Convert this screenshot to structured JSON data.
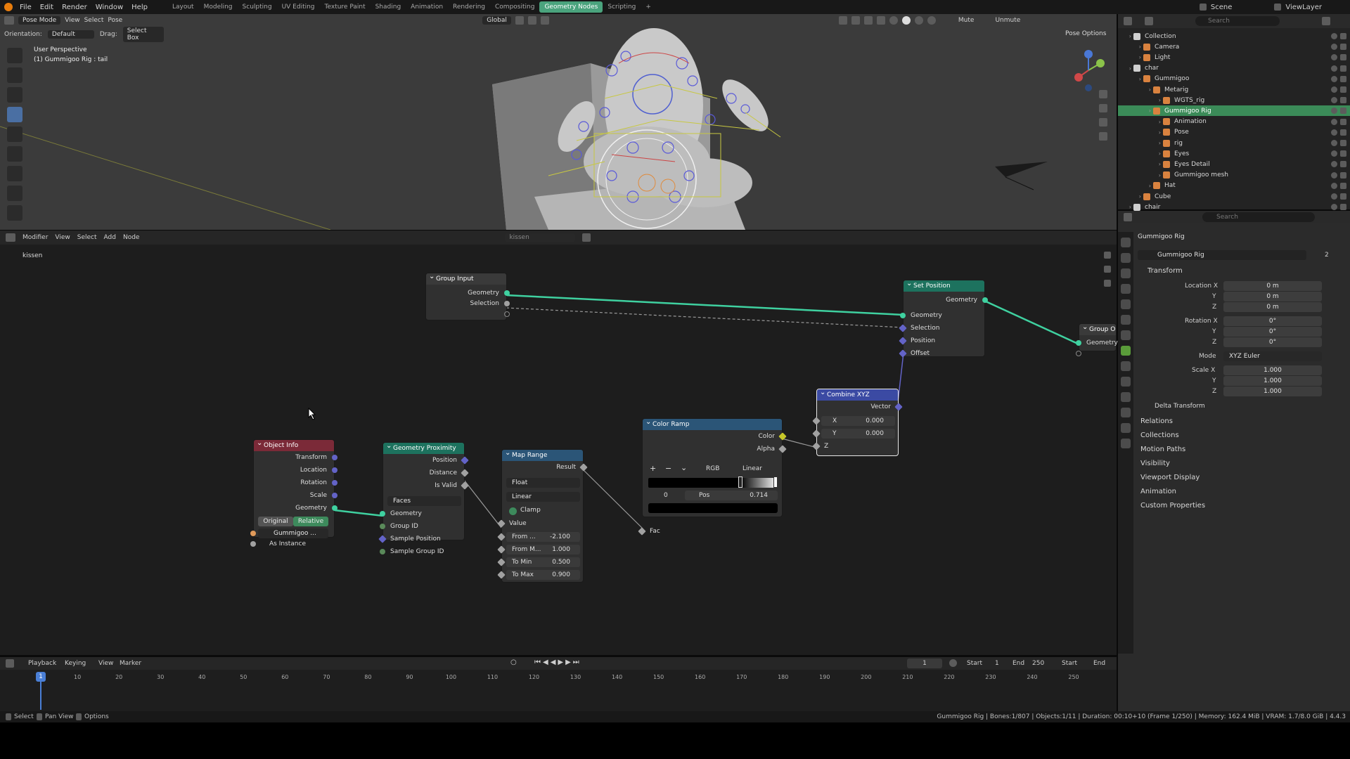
{
  "menu": [
    "File",
    "Edit",
    "Render",
    "Window",
    "Help"
  ],
  "workspaces": [
    "Layout",
    "Modeling",
    "Sculpting",
    "UV Editing",
    "Texture Paint",
    "Shading",
    "Animation",
    "Rendering",
    "Compositing",
    "Geometry Nodes",
    "Scripting"
  ],
  "active_workspace": "Geometry Nodes",
  "scene_label": "Scene",
  "viewlayer_label": "ViewLayer",
  "viewport": {
    "mode": "Pose Mode",
    "view": "View",
    "select": "Select",
    "pose": "Pose",
    "orientation_label": "Orientation:",
    "orientation": "Default",
    "drag_label": "Drag:",
    "drag": "Select Box",
    "transform": "Global",
    "mute": "Mute",
    "unmute": "Unmute",
    "pose_options": "Pose Options",
    "overlay_title": "User Perspective",
    "overlay_sub": "(1) Gummigoo Rig : tail"
  },
  "outliner": {
    "search": "Search",
    "items": [
      {
        "label": "Collection",
        "depth": 0
      },
      {
        "label": "Camera",
        "depth": 1
      },
      {
        "label": "Light",
        "depth": 1
      },
      {
        "label": "char",
        "depth": 0
      },
      {
        "label": "Gummigoo",
        "depth": 1
      },
      {
        "label": "Metarig",
        "depth": 2
      },
      {
        "label": "WGTS_rig",
        "depth": 3
      },
      {
        "label": "Gummigoo Rig",
        "depth": 2,
        "selected": true
      },
      {
        "label": "Animation",
        "depth": 3
      },
      {
        "label": "Pose",
        "depth": 3
      },
      {
        "label": "rig",
        "depth": 3
      },
      {
        "label": "Eyes",
        "depth": 3
      },
      {
        "label": "Eyes Detail",
        "depth": 3
      },
      {
        "label": "Gummigoo mesh",
        "depth": 3
      },
      {
        "label": "Hat",
        "depth": 2
      },
      {
        "label": "Cube",
        "depth": 1
      },
      {
        "label": "chair",
        "depth": 0
      }
    ]
  },
  "properties": {
    "search": "Search",
    "object": "Gummigoo Rig",
    "object_field": "Gummigoo Rig",
    "users": "2",
    "transform": "Transform",
    "location_label": "Location X",
    "rotation_label": "Rotation X",
    "scale_label": "Scale X",
    "y": "Y",
    "z": "Z",
    "location": [
      "0 m",
      "0 m",
      "0 m"
    ],
    "rotation": [
      "0°",
      "0°",
      "0°"
    ],
    "mode_label": "Mode",
    "mode": "XYZ Euler",
    "scale": [
      "1.000",
      "1.000",
      "1.000"
    ],
    "delta": "Delta Transform",
    "sections": [
      "Relations",
      "Collections",
      "Motion Paths",
      "Visibility",
      "Viewport Display",
      "Animation",
      "Custom Properties"
    ]
  },
  "node_editor": {
    "menus": [
      "Modifier",
      "View",
      "Select",
      "Add",
      "Node"
    ],
    "tree_name": "kissen",
    "breadcrumb": "kissen",
    "group_input": {
      "title": "Group Input",
      "geometry": "Geometry",
      "selection": "Selection"
    },
    "set_position": {
      "title": "Set Position",
      "geometry_out": "Geometry",
      "geometry": "Geometry",
      "selection": "Selection",
      "position": "Position",
      "offset": "Offset"
    },
    "group_output": {
      "title": "Group O",
      "geometry": "Geometry"
    },
    "object_info": {
      "title": "Object Info",
      "transform": "Transform",
      "location": "Location",
      "rotation": "Rotation",
      "scale": "Scale",
      "geometry": "Geometry",
      "original": "Original",
      "relative": "Relative",
      "object": "Gummigoo ...",
      "as_instance": "As Instance"
    },
    "proximity": {
      "title": "Geometry Proximity",
      "position": "Position",
      "distance": "Distance",
      "is_valid": "Is Valid",
      "target": "Faces",
      "geometry": "Geometry",
      "group_id": "Group ID",
      "sample_position": "Sample Position",
      "sample_group_id": "Sample Group ID"
    },
    "map_range": {
      "title": "Map Range",
      "result": "Result",
      "type": "Float",
      "interp": "Linear",
      "clamp": "Clamp",
      "value": "Value",
      "from_min_label": "From ...",
      "from_min": "-2.100",
      "from_max_label": "From M...",
      "from_max": "1.000",
      "to_min_label": "To Min",
      "to_min": "0.500",
      "to_max_label": "To Max",
      "to_max": "0.900"
    },
    "color_ramp": {
      "title": "Color Ramp",
      "color": "Color",
      "alpha": "Alpha",
      "mode": "RGB",
      "interp": "Linear",
      "index": "0",
      "pos_label": "Pos",
      "pos": "0.714",
      "fac": "Fac"
    },
    "combine": {
      "title": "Combine XYZ",
      "vector": "Vector",
      "x_label": "X",
      "x": "0.000",
      "y_label": "Y",
      "y": "0.000",
      "z_label": "Z"
    }
  },
  "timeline": {
    "menus": [
      "Playback",
      "Keying",
      "View",
      "Marker"
    ],
    "frame": "1",
    "start_label": "Start",
    "start": "1",
    "end_label": "End",
    "end": "250",
    "start2": "Start",
    "end2": "End",
    "ticks": [
      "1",
      "10",
      "20",
      "30",
      "40",
      "50",
      "60",
      "70",
      "80",
      "90",
      "100",
      "110",
      "120",
      "130",
      "140",
      "150",
      "160",
      "170",
      "180",
      "190",
      "200",
      "210",
      "220",
      "230",
      "240",
      "250"
    ]
  },
  "status": {
    "select": "Select",
    "pan": "Pan View",
    "options": "Options",
    "info": "Gummigoo Rig | Bones:1/807 | Objects:1/11 | Duration: 00:10+10 (Frame 1/250) | Memory: 162.4 MiB | VRAM: 1.7/8.0 GiB | 4.4.3"
  },
  "colors": {
    "accent": "#4aa37d",
    "node_geo": "#1d725e",
    "node_input": "#7b2a38",
    "node_convert": "#2b5577",
    "node_vector": "#3b4aa3",
    "socket_geo": "#3fd1a0"
  }
}
